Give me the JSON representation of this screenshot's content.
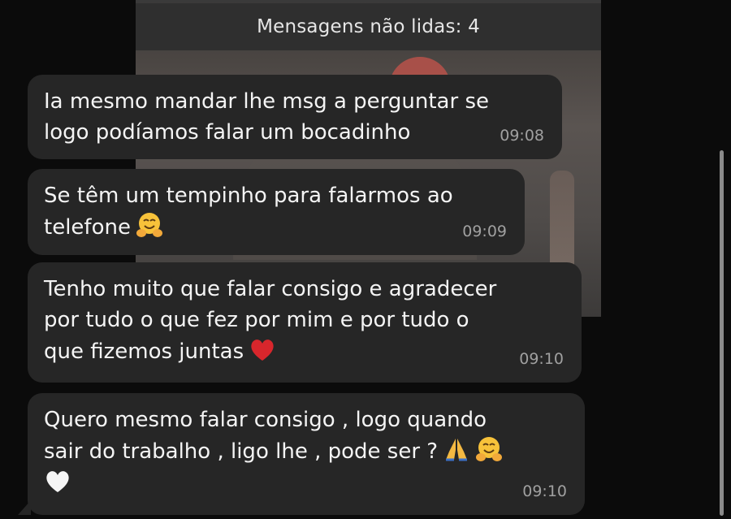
{
  "banner": {
    "unread_label": "Mensagens não lidas: 4"
  },
  "messages": [
    {
      "text": "Ia mesmo mandar lhe msg a perguntar se\nlogo podíamos falar um bocadinho",
      "time": "09:08",
      "emojis": []
    },
    {
      "text": "Se têm um tempinho para falarmos ao\ntelefone",
      "time": "09:09",
      "emojis": [
        "hugging-face"
      ]
    },
    {
      "text": "Tenho muito que falar consigo e agradecer\npor tudo o que fez por mim e por tudo o\nque fizemos juntas",
      "time": "09:10",
      "emojis": [
        "red-heart"
      ]
    },
    {
      "text": "Quero mesmo falar consigo , logo quando\nsair do trabalho , ligo lhe , pode ser ?",
      "time": "09:10",
      "emojis": [
        "folded-hands",
        "hugging-face",
        "white-heart"
      ]
    }
  ],
  "colors": {
    "background": "#0b0b0b",
    "bubble": "#262626",
    "banner": "#2f2f2f",
    "timestamp": "#a0a0a0",
    "heart_red": "#d8262c"
  }
}
